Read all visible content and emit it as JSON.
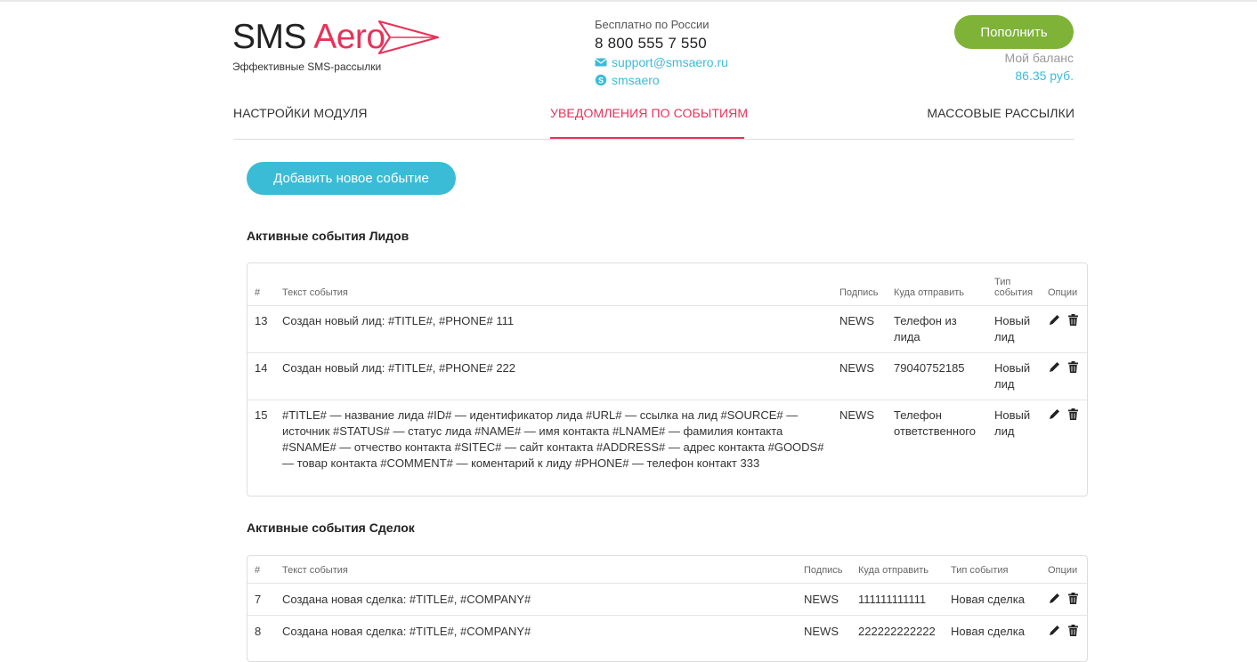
{
  "brand": {
    "name_sms": "SMS",
    "name_aero": "Aero",
    "tagline": "Эффективные SMS-рассылки",
    "accent": "#e8325a",
    "logo_icon": "paper-plane-icon"
  },
  "contacts": {
    "free_label": "Бесплатно по России",
    "phone": "8 800 555 7 550",
    "email": "support@smsaero.ru",
    "email_icon": "envelope-icon",
    "skype": "smsaero",
    "skype_icon": "skype-icon",
    "link_color": "#3bbcd6"
  },
  "account": {
    "topup_label": "Пополнить",
    "topup_color": "#7eb338",
    "balance_label": "Мой баланс",
    "balance_value": "86.35 руб."
  },
  "tabs": [
    {
      "label": "НАСТРОЙКИ МОДУЛЯ",
      "active": false
    },
    {
      "label": "УВЕДОМЛЕНИЯ ПО СОБЫТИЯМ",
      "active": true
    },
    {
      "label": "МАССОВЫЕ РАССЫЛКИ",
      "active": false
    }
  ],
  "add_event_label": "Добавить новое событие",
  "leads": {
    "title": "Активные события Лидов",
    "columns": [
      "#",
      "Текст события",
      "Подпись",
      "Куда отправить",
      "Тип события",
      "Опции"
    ],
    "rows": [
      {
        "id": "13",
        "text": "Создан новый лид: #TITLE#, #PHONE# 111",
        "signature": "NEWS",
        "to": "Телефон из лида",
        "type": "Новый лид"
      },
      {
        "id": "14",
        "text": "Создан новый лид: #TITLE#, #PHONE# 222",
        "signature": "NEWS",
        "to": "79040752185",
        "type": "Новый лид"
      },
      {
        "id": "15",
        "text": "#TITLE# — название лида #ID# — идентификатор лида #URL# — ссылка на лид #SOURCE# — источник #STATUS# — статус лида #NAME# — имя контакта #LNAME# — фамилия контакта #SNAME# — отчество контакта #SITEC# — сайт контакта #ADDRESS# — адрес контакта #GOODS# — товар контакта #COMMENT# — коментарий к лиду #PHONE# — телефон контакт 333",
        "signature": "NEWS",
        "to": "Телефон ответственного",
        "type": "Новый лид"
      }
    ]
  },
  "deals": {
    "title": "Активные события Сделок",
    "columns": [
      "#",
      "Текст события",
      "Подпись",
      "Куда отправить",
      "Тип события",
      "Опции"
    ],
    "rows": [
      {
        "id": "7",
        "text": "Создана новая сделка: #TITLE#, #COMPANY#",
        "signature": "NEWS",
        "to": "111111111111",
        "type": "Новая сделка"
      },
      {
        "id": "8",
        "text": "Создана новая сделка: #TITLE#, #COMPANY#",
        "signature": "NEWS",
        "to": "222222222222",
        "type": "Новая сделка"
      }
    ]
  },
  "row_icons": {
    "edit": "pencil-icon",
    "delete": "trash-icon"
  }
}
